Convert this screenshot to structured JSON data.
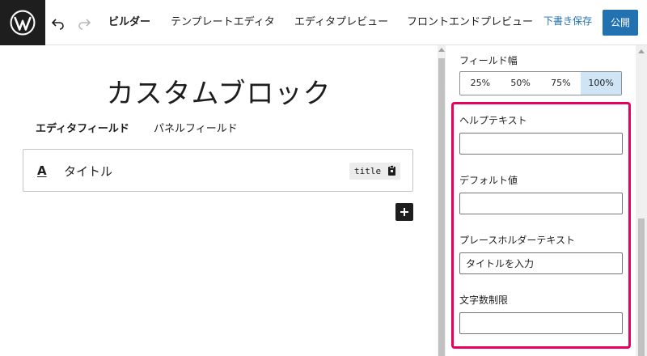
{
  "header": {
    "tabs": [
      {
        "label": "ビルダー",
        "active": true
      },
      {
        "label": "テンプレートエディタ",
        "active": false
      },
      {
        "label": "エディタプレビュー",
        "active": false
      },
      {
        "label": "フロントエンドプレビュー",
        "active": false
      }
    ],
    "draft_label": "下書き保存",
    "publish_label": "公開",
    "icons": {
      "logo": "wordpress-logo",
      "undo": "undo-icon",
      "redo": "redo-icon"
    }
  },
  "canvas": {
    "block_title": "カスタムブロック",
    "field_tabs": [
      {
        "label": "エディタフィールド",
        "active": true
      },
      {
        "label": "パネルフィールド",
        "active": false
      }
    ],
    "field": {
      "icon_glyph": "A",
      "label": "タイトル",
      "slug": "title"
    }
  },
  "sidebar": {
    "field_width": {
      "label": "フィールド幅",
      "options": [
        "25%",
        "50%",
        "75%",
        "100%"
      ],
      "selected": "100%"
    },
    "help_text": {
      "label": "ヘルプテキスト",
      "value": ""
    },
    "default_value": {
      "label": "デフォルト値",
      "value": ""
    },
    "placeholder": {
      "label": "プレースホルダーテキスト",
      "value": "タイトルを入力"
    },
    "char_limit": {
      "label": "文字数制限",
      "value": ""
    }
  },
  "colors": {
    "accent": "#2271b1",
    "highlight": "#e8005f",
    "selected_bg": "#cfe5f6",
    "dark": "#1e1e1e"
  }
}
